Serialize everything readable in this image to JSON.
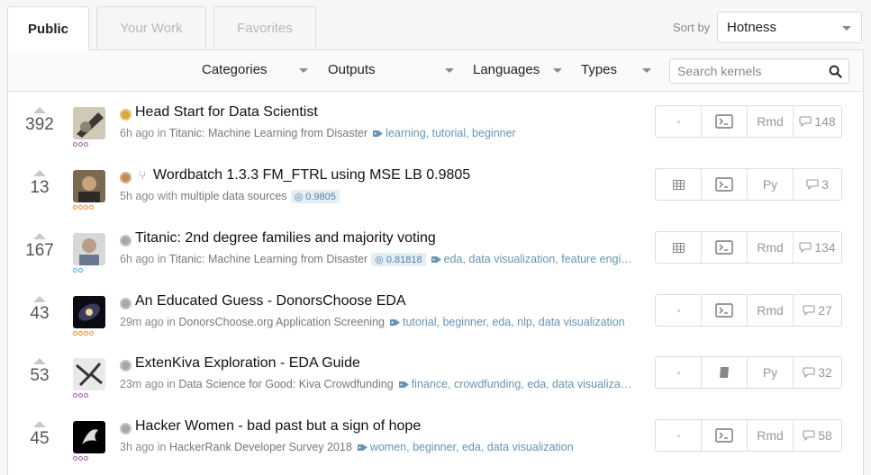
{
  "tabs": [
    {
      "label": "Public"
    },
    {
      "label": "Your Work"
    },
    {
      "label": "Favorites"
    }
  ],
  "sort": {
    "label": "Sort by",
    "value": "Hotness"
  },
  "filters": [
    {
      "label": "Categories"
    },
    {
      "label": "Outputs"
    },
    {
      "label": "Languages"
    },
    {
      "label": "Types"
    }
  ],
  "search": {
    "placeholder": "Search kernels"
  },
  "colors": {
    "tier_purple": "#9e5ba8",
    "tier_orange": "#f0882f",
    "tier_blue": "#2bb5e8",
    "tag": "#6794b3",
    "medal_gold": "#d8a93b",
    "medal_bronze": "#c38a58",
    "medal_none": "#a8a8a8"
  },
  "kernels": [
    {
      "votes": "392",
      "title": "Head Start for Data Scientist",
      "medal": "gold",
      "forked": false,
      "time": "6h ago",
      "in_label": "in",
      "source": "Titanic: Machine Learning from Disaster",
      "score": "",
      "tags": "learning, tutorial, beginner",
      "output_icon": "dot",
      "code_icon": "terminal-icon",
      "lang": "Rmd",
      "comments": "148",
      "tier": "purple"
    },
    {
      "votes": "13",
      "title": "Wordbatch 1.3.3 FM_FTRL using MSE LB 0.9805",
      "medal": "bronze",
      "forked": true,
      "time": "5h ago",
      "in_label": "with",
      "source": "multiple data sources",
      "score": "0.9805",
      "tags": "",
      "output_icon": "table-icon",
      "code_icon": "terminal-icon",
      "lang": "Py",
      "comments": "3",
      "tier": "orange"
    },
    {
      "votes": "167",
      "title": "Titanic: 2nd degree families and majority voting",
      "medal": "none",
      "forked": false,
      "time": "6h ago",
      "in_label": "in",
      "source": "Titanic: Machine Learning from Disaster",
      "score": "0.81818",
      "tags": "eda, data visualization, feature engi…",
      "output_icon": "table-icon",
      "code_icon": "terminal-icon",
      "lang": "Rmd",
      "comments": "134",
      "tier": "blue"
    },
    {
      "votes": "43",
      "title": "An Educated Guess - DonorsChoose EDA",
      "medal": "none",
      "forked": false,
      "time": "29m ago",
      "in_label": "in",
      "source": "DonorsChoose.org Application Screening",
      "score": "",
      "tags": "tutorial, beginner, eda, nlp, data visualization",
      "output_icon": "dot",
      "code_icon": "terminal-icon",
      "lang": "Rmd",
      "comments": "27",
      "tier": "orange"
    },
    {
      "votes": "53",
      "title": "ExtenKiva Exploration - EDA Guide",
      "medal": "none",
      "forked": false,
      "time": "23m ago",
      "in_label": "in",
      "source": "Data Science for Good: Kiva Crowdfunding",
      "score": "",
      "tags": "finance, crowdfunding, eda, data visualiza…",
      "output_icon": "dot",
      "code_icon": "notebook-icon",
      "lang": "Py",
      "comments": "32",
      "tier": "purple"
    },
    {
      "votes": "45",
      "title": "Hacker Women - bad past but a sign of hope",
      "medal": "none",
      "forked": false,
      "time": "3h ago",
      "in_label": "in",
      "source": "HackerRank Developer Survey 2018",
      "score": "",
      "tags": "women, beginner, eda, data visualization",
      "output_icon": "dot",
      "code_icon": "terminal-icon",
      "lang": "Rmd",
      "comments": "58",
      "tier": "purple"
    }
  ]
}
